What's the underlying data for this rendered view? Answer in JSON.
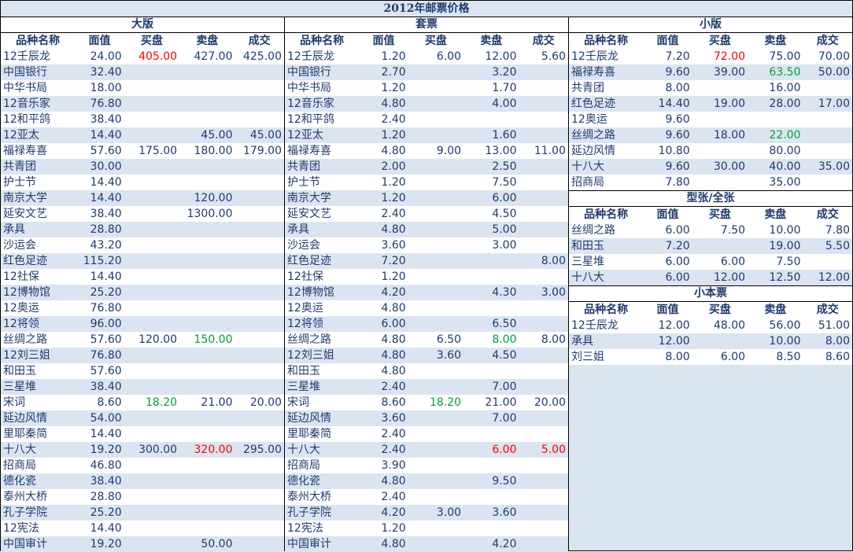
{
  "title": "2012年邮票价格",
  "headers": [
    "品种名称",
    "面值",
    "买盘",
    "卖盘",
    "成交"
  ],
  "colors": {
    "blue_text": "#1f3a6e",
    "alt_row": "#dbe5f1",
    "up": "#ff0000",
    "down": "#00a03c"
  },
  "sections": {
    "dabans": {
      "title": "大版",
      "rows": [
        {
          "name": "12壬辰龙",
          "face": "24.00",
          "buy": "405.00",
          "buy_color": "red",
          "sell": "427.00",
          "deal": "425.00"
        },
        {
          "name": "中国银行",
          "face": "32.40",
          "buy": "",
          "sell": "",
          "deal": ""
        },
        {
          "name": "中华书局",
          "face": "18.00",
          "buy": "",
          "sell": "",
          "deal": ""
        },
        {
          "name": "12音乐家",
          "face": "76.80",
          "buy": "",
          "sell": "",
          "deal": ""
        },
        {
          "name": "12和平鸽",
          "face": "38.40",
          "buy": "",
          "sell": "",
          "deal": ""
        },
        {
          "name": "12亚太",
          "face": "14.40",
          "buy": "",
          "sell": "45.00",
          "deal": "45.00"
        },
        {
          "name": "福禄寿喜",
          "face": "57.60",
          "buy": "175.00",
          "sell": "180.00",
          "deal": "179.00"
        },
        {
          "name": "共青团",
          "face": "30.00",
          "buy": "",
          "sell": "",
          "deal": ""
        },
        {
          "name": "护士节",
          "face": "14.40",
          "buy": "",
          "sell": "",
          "deal": ""
        },
        {
          "name": "南京大学",
          "face": "14.40",
          "buy": "",
          "sell": "120.00",
          "deal": ""
        },
        {
          "name": "延安文艺",
          "face": "38.40",
          "buy": "",
          "sell": "1300.00",
          "deal": ""
        },
        {
          "name": "承具",
          "face": "28.80",
          "buy": "",
          "sell": "",
          "deal": ""
        },
        {
          "name": "沙运会",
          "face": "43.20",
          "buy": "",
          "sell": "",
          "deal": ""
        },
        {
          "name": "红色足迹",
          "face": "115.20",
          "buy": "",
          "sell": "",
          "deal": ""
        },
        {
          "name": "12社保",
          "face": "14.40",
          "buy": "",
          "sell": "",
          "deal": ""
        },
        {
          "name": "12博物馆",
          "face": "25.20",
          "buy": "",
          "sell": "",
          "deal": ""
        },
        {
          "name": "12奥运",
          "face": "76.80",
          "buy": "",
          "sell": "",
          "deal": ""
        },
        {
          "name": "12将领",
          "face": "96.00",
          "buy": "",
          "sell": "",
          "deal": ""
        },
        {
          "name": "丝绸之路",
          "face": "57.60",
          "buy": "120.00",
          "sell": "150.00",
          "sell_color": "green",
          "deal": ""
        },
        {
          "name": "12刘三姐",
          "face": "76.80",
          "buy": "",
          "sell": "",
          "deal": ""
        },
        {
          "name": "和田玉",
          "face": "57.60",
          "buy": "",
          "sell": "",
          "deal": ""
        },
        {
          "name": "三星堆",
          "face": "38.40",
          "buy": "",
          "sell": "",
          "deal": ""
        },
        {
          "name": "宋词",
          "face": "8.60",
          "buy": "18.20",
          "buy_color": "green",
          "sell": "21.00",
          "deal": "20.00"
        },
        {
          "name": "延边风情",
          "face": "54.00",
          "buy": "",
          "sell": "",
          "deal": ""
        },
        {
          "name": "里耶秦简",
          "face": "14.40",
          "buy": "",
          "sell": "",
          "deal": ""
        },
        {
          "name": "十八大",
          "face": "19.20",
          "buy": "300.00",
          "sell": "320.00",
          "sell_color": "red",
          "deal": "295.00"
        },
        {
          "name": "招商局",
          "face": "46.80",
          "buy": "",
          "sell": "",
          "deal": ""
        },
        {
          "name": "德化瓷",
          "face": "38.40",
          "buy": "",
          "sell": "",
          "deal": ""
        },
        {
          "name": "泰州大桥",
          "face": "28.80",
          "buy": "",
          "sell": "",
          "deal": ""
        },
        {
          "name": "孔子学院",
          "face": "25.20",
          "buy": "",
          "sell": "",
          "deal": ""
        },
        {
          "name": "12宪法",
          "face": "14.40",
          "buy": "",
          "sell": "",
          "deal": ""
        },
        {
          "name": "中国审计",
          "face": "19.20",
          "buy": "",
          "sell": "50.00",
          "deal": ""
        }
      ]
    },
    "taopiao": {
      "title": "套票",
      "rows": [
        {
          "name": "12壬辰龙",
          "face": "1.20",
          "buy": "6.00",
          "sell": "12.00",
          "deal": "5.60"
        },
        {
          "name": "中国银行",
          "face": "2.70",
          "buy": "",
          "sell": "3.20",
          "deal": ""
        },
        {
          "name": "中华书局",
          "face": "1.20",
          "buy": "",
          "sell": "1.70",
          "deal": ""
        },
        {
          "name": "12音乐家",
          "face": "4.80",
          "buy": "",
          "sell": "4.00",
          "deal": ""
        },
        {
          "name": "12和平鸽",
          "face": "2.40",
          "buy": "",
          "sell": "",
          "deal": ""
        },
        {
          "name": "12亚太",
          "face": "1.20",
          "buy": "",
          "sell": "1.60",
          "deal": ""
        },
        {
          "name": "福禄寿喜",
          "face": "4.80",
          "buy": "9.00",
          "sell": "13.00",
          "deal": "11.00"
        },
        {
          "name": "共青团",
          "face": "2.00",
          "buy": "",
          "sell": "2.50",
          "deal": ""
        },
        {
          "name": "护士节",
          "face": "1.20",
          "buy": "",
          "sell": "7.50",
          "deal": ""
        },
        {
          "name": "南京大学",
          "face": "1.20",
          "buy": "",
          "sell": "6.00",
          "deal": ""
        },
        {
          "name": "延安文艺",
          "face": "2.40",
          "buy": "",
          "sell": "4.50",
          "deal": ""
        },
        {
          "name": "承具",
          "face": "4.80",
          "buy": "",
          "sell": "5.00",
          "deal": ""
        },
        {
          "name": "沙运会",
          "face": "3.60",
          "buy": "",
          "sell": "3.00",
          "deal": ""
        },
        {
          "name": "红色足迹",
          "face": "7.20",
          "buy": "",
          "sell": "",
          "deal": "8.00"
        },
        {
          "name": "12社保",
          "face": "1.20",
          "buy": "",
          "sell": "",
          "deal": ""
        },
        {
          "name": "12博物馆",
          "face": "4.20",
          "buy": "",
          "sell": "4.30",
          "deal": "3.00"
        },
        {
          "name": "12奥运",
          "face": "4.80",
          "buy": "",
          "sell": "",
          "deal": ""
        },
        {
          "name": "12将领",
          "face": "6.00",
          "buy": "",
          "sell": "6.50",
          "deal": ""
        },
        {
          "name": "丝绸之路",
          "face": "4.80",
          "buy": "6.50",
          "sell": "8.00",
          "sell_color": "green",
          "deal": "8.00"
        },
        {
          "name": "12刘三姐",
          "face": "4.80",
          "buy": "3.60",
          "sell": "4.50",
          "deal": ""
        },
        {
          "name": "和田玉",
          "face": "4.80",
          "buy": "",
          "sell": "",
          "deal": ""
        },
        {
          "name": "三星堆",
          "face": "2.40",
          "buy": "",
          "sell": "7.00",
          "deal": ""
        },
        {
          "name": "宋词",
          "face": "8.60",
          "buy": "18.20",
          "buy_color": "green",
          "sell": "21.00",
          "deal": "20.00"
        },
        {
          "name": "延边风情",
          "face": "3.60",
          "buy": "",
          "sell": "7.00",
          "deal": ""
        },
        {
          "name": "里耶秦简",
          "face": "2.40",
          "buy": "",
          "sell": "",
          "deal": ""
        },
        {
          "name": "十八大",
          "face": "2.40",
          "buy": "",
          "sell": "6.00",
          "sell_color": "red",
          "deal": "5.00",
          "deal_color": "red"
        },
        {
          "name": "招商局",
          "face": "3.90",
          "buy": "",
          "sell": "",
          "deal": ""
        },
        {
          "name": "德化瓷",
          "face": "4.80",
          "buy": "",
          "sell": "9.50",
          "deal": ""
        },
        {
          "name": "泰州大桥",
          "face": "2.40",
          "buy": "",
          "sell": "",
          "deal": ""
        },
        {
          "name": "孔子学院",
          "face": "4.20",
          "buy": "3.00",
          "sell": "3.60",
          "deal": ""
        },
        {
          "name": "12宪法",
          "face": "1.20",
          "buy": "",
          "sell": "",
          "deal": ""
        },
        {
          "name": "中国审计",
          "face": "4.80",
          "buy": "",
          "sell": "4.20",
          "deal": ""
        }
      ]
    },
    "xiaoban": {
      "title": "小版",
      "rows": [
        {
          "name": "12壬辰龙",
          "face": "7.20",
          "buy": "72.00",
          "buy_color": "red",
          "sell": "75.00",
          "deal": "70.00"
        },
        {
          "name": "福禄寿喜",
          "face": "9.60",
          "buy": "39.00",
          "sell": "63.50",
          "sell_color": "green",
          "deal": "50.00"
        },
        {
          "name": "共青团",
          "face": "8.00",
          "buy": "",
          "sell": "16.00",
          "deal": ""
        },
        {
          "name": "红色足迹",
          "face": "14.40",
          "buy": "19.00",
          "sell": "28.00",
          "deal": "17.00"
        },
        {
          "name": "12奥运",
          "face": "9.60",
          "buy": "",
          "sell": "",
          "deal": ""
        },
        {
          "name": "丝绸之路",
          "face": "9.60",
          "buy": "18.00",
          "sell": "22.00",
          "sell_color": "green",
          "deal": ""
        },
        {
          "name": "延边风情",
          "face": "10.80",
          "buy": "",
          "sell": "80.00",
          "deal": ""
        },
        {
          "name": "十八大",
          "face": "9.60",
          "buy": "30.00",
          "sell": "40.00",
          "deal": "35.00"
        },
        {
          "name": "招商局",
          "face": "7.80",
          "buy": "",
          "sell": "35.00",
          "deal": ""
        }
      ]
    },
    "xingzhang": {
      "title": "型张/全张",
      "rows": [
        {
          "name": "丝绸之路",
          "face": "6.00",
          "buy": "7.50",
          "sell": "10.00",
          "deal": "7.80"
        },
        {
          "name": "和田玉",
          "face": "7.20",
          "buy": "",
          "sell": "19.00",
          "deal": "5.50"
        },
        {
          "name": "三星堆",
          "face": "6.00",
          "buy": "6.00",
          "sell": "7.50",
          "deal": ""
        },
        {
          "name": "十八大",
          "face": "6.00",
          "buy": "12.00",
          "sell": "12.50",
          "deal": "12.00"
        }
      ]
    },
    "xiaobenpiao": {
      "title": "小本票",
      "rows": [
        {
          "name": "12壬辰龙",
          "face": "12.00",
          "buy": "48.00",
          "sell": "56.00",
          "deal": "51.00"
        },
        {
          "name": "承具",
          "face": "12.00",
          "buy": "",
          "sell": "10.00",
          "deal": "8.00"
        },
        {
          "name": "刘三姐",
          "face": "8.00",
          "buy": "6.00",
          "sell": "8.50",
          "deal": "8.60"
        }
      ]
    }
  }
}
